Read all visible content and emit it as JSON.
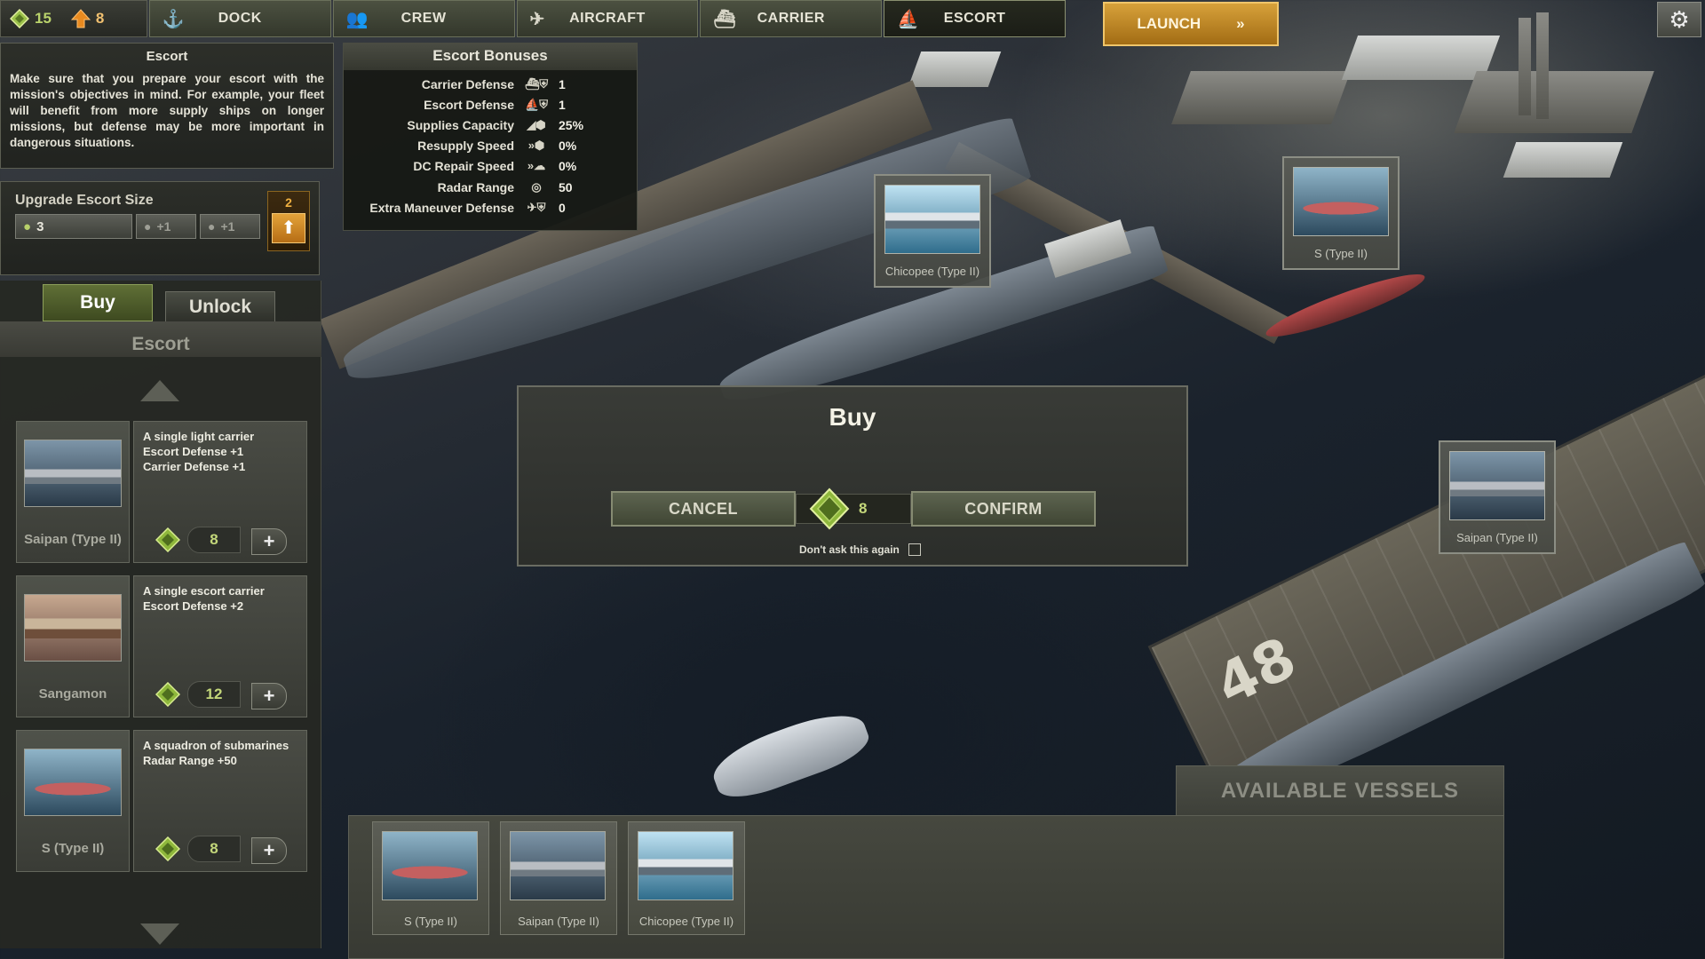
{
  "resources": {
    "supplies": "15",
    "upgrades": "8",
    "supplies_icon": "diamond-resource-icon",
    "upgrades_icon": "upgrade-arrow-icon"
  },
  "nav": {
    "tabs": [
      {
        "label": "DOCK",
        "icon": "anchor-icon"
      },
      {
        "label": "CREW",
        "icon": "crew-icon"
      },
      {
        "label": "AIRCRAFT",
        "icon": "aircraft-icon"
      },
      {
        "label": "CARRIER",
        "icon": "carrier-icon"
      },
      {
        "label": "ESCORT",
        "icon": "escort-fleet-icon"
      }
    ],
    "active": "ESCORT",
    "launch": "LAUNCH",
    "launch_icon": "double-chevron-right-icon",
    "settings_icon": "gear-icon"
  },
  "escort_info": {
    "title": "Escort",
    "text": "Make sure that you prepare your escort with the mission's objectives in mind. For example, your fleet will benefit from more supply ships on longer missions, but defense may be more important in dangerous situations."
  },
  "upgrade": {
    "title": "Upgrade Escort Size",
    "current": "3",
    "next1": "+1",
    "next2": "+1",
    "cost": "2"
  },
  "bonuses": {
    "title": "Escort Bonuses",
    "rows": [
      {
        "label": "Carrier Defense",
        "value": "1"
      },
      {
        "label": "Escort Defense",
        "value": "1"
      },
      {
        "label": "Supplies Capacity",
        "value": "25%"
      },
      {
        "label": "Resupply Speed",
        "value": "0%"
      },
      {
        "label": "DC Repair Speed",
        "value": "0%"
      },
      {
        "label": "Radar Range",
        "value": "50"
      },
      {
        "label": "Extra Maneuver Defense",
        "value": "0"
      }
    ]
  },
  "shop": {
    "tab_buy": "Buy",
    "tab_unlock": "Unlock",
    "list_title": "Escort",
    "items": [
      {
        "name": "Saipan (Type II)",
        "desc": "A single light carrier\nEscort Defense +1\nCarrier Defense +1",
        "price": "8"
      },
      {
        "name": "Sangamon",
        "desc": "A single escort carrier\nEscort Defense +2",
        "price": "12"
      },
      {
        "name": "S (Type II)",
        "desc": "A squadron of submarines\nRadar Range +50",
        "price": "8"
      }
    ],
    "plus": "+"
  },
  "scene_labels": {
    "chicopee": "Chicopee (Type II)",
    "s_type": "S (Type II)",
    "saipan": "Saipan (Type II)",
    "deck_number": "48"
  },
  "dialog": {
    "title": "Buy",
    "cancel": "CANCEL",
    "confirm": "CONFIRM",
    "price": "8",
    "dont_ask": "Don't ask this again",
    "dont_ask_checked": false
  },
  "available": {
    "title": "AVAILABLE VESSELS",
    "items": [
      {
        "name": "S (Type II)"
      },
      {
        "name": "Saipan (Type II)"
      },
      {
        "name": "Chicopee (Type II)"
      }
    ]
  },
  "colors": {
    "accent_green": "#c5d87b",
    "launch_orange": "#d7a13a",
    "panel_dark": "#2c2e28"
  }
}
